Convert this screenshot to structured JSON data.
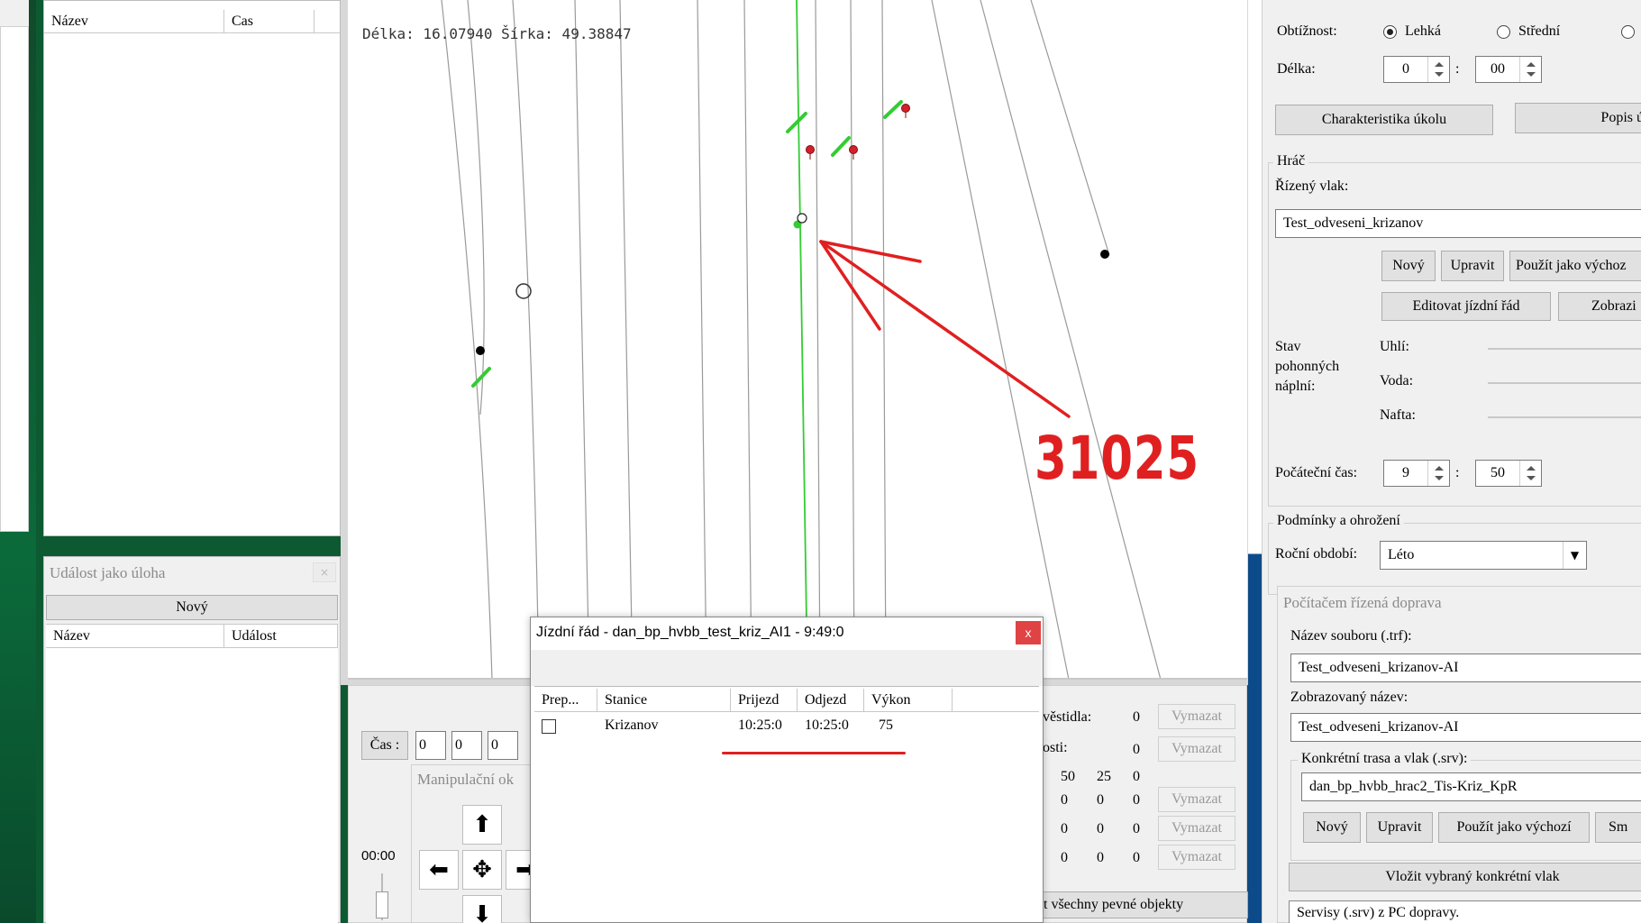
{
  "left_list": {
    "col_name": "Název",
    "col_time": "Cas"
  },
  "event_task": {
    "title": "Událost jako úloha",
    "new_button": "Nový",
    "col_name": "Název",
    "col_event": "Událost"
  },
  "map": {
    "coords": "Délka: 16.07940 Šírka: 49.38847",
    "annotation": "31025",
    "annotation_color": "#e02020",
    "track_color": "#33cc33"
  },
  "timetable": {
    "title": "Jízdní řád - dan_bp_hvbb_test_kriz_AI1 - 9:49:0",
    "close": "x",
    "columns": [
      "Prep...",
      "Stanice",
      "Prijezd",
      "Odjezd",
      "Výkon"
    ],
    "rows": [
      {
        "station": "Krizanov",
        "arrival": "10:25:0",
        "departure": "10:25:0",
        "performance": "75"
      }
    ]
  },
  "bottom_left": {
    "time_label": "Čas :",
    "time_values": [
      "0",
      "0",
      "0"
    ],
    "manip_title": "Manipulační ok",
    "clock": "00:00"
  },
  "bottom_mid": {
    "labels": [
      "věstidla:",
      "osti:"
    ],
    "counts": [
      "0",
      "0"
    ],
    "grid": [
      [
        "50",
        "25",
        "0"
      ],
      [
        "0",
        "0",
        "0"
      ],
      [
        "0",
        "0",
        "0"
      ],
      [
        "0",
        "0",
        "0"
      ]
    ],
    "delete_label": "Vymazat",
    "all_fixed": "t všechny pevné objekty"
  },
  "right": {
    "difficulty_label": "Obtížnost:",
    "difficulty_options": [
      "Lehká",
      "Střední"
    ],
    "length_label": "Délka:",
    "length_hours": "0",
    "length_minutes": "00",
    "task_characteristic": "Charakteristika úkolu",
    "task_description": "Popis úko",
    "player_group": "Hráč",
    "controlled_train_label": "Řízený vlak:",
    "controlled_train_value": "Test_odveseni_krizanov",
    "new_btn": "Nový",
    "edit_btn": "Upravit",
    "use_default_btn": "Použít jako výchoz",
    "edit_timetable_btn": "Editovat jízdní řád",
    "show_btn": "Zobrazi",
    "fuel_label_1": "Stav",
    "fuel_label_2": "pohonných",
    "fuel_label_3": "náplní:",
    "coal_label": "Uhlí:",
    "water_label": "Voda:",
    "diesel_label": "Nafta:",
    "start_time_label": "Počáteční čas:",
    "start_hour": "9",
    "start_minute": "50",
    "conditions_group": "Podmínky a ohrožení",
    "season_label": "Roční období:",
    "season_value": "Léto",
    "ai_panel_title": "Počítačem řízená doprava",
    "filename_label": "Název souboru (.trf):",
    "filename_value": "Test_odveseni_krizanov-AI",
    "display_name_label": "Zobrazovaný název:",
    "display_name_value": "Test_odveseni_krizanov-AI",
    "route_group": "Konkrétní trasa a vlak (.srv):",
    "route_value": "dan_bp_hvbb_hrac2_Tis-Kriz_KpR",
    "new2_btn": "Nový",
    "edit2_btn": "Upravit",
    "use_default2_btn": "Použít jako výchozí",
    "sm_btn": "Sm",
    "insert_btn": "Vložit vybraný konkrétní vlak",
    "services_label": "Servisy (.srv) z PC dopravy."
  }
}
